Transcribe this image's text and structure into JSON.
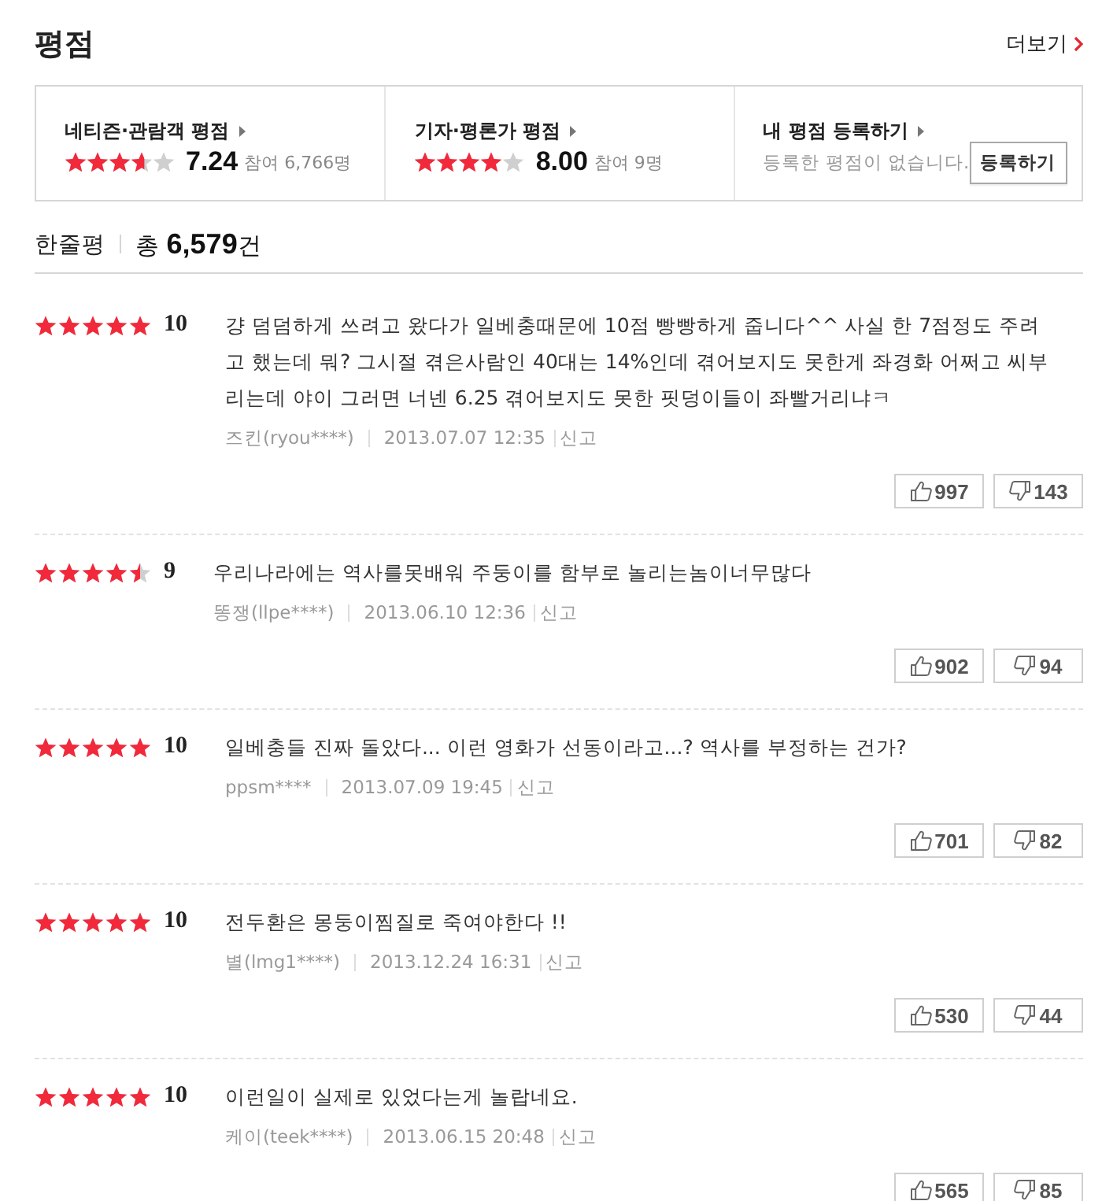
{
  "title": "평점",
  "more_link": "더보기",
  "rating_summary": [
    {
      "kind": "score",
      "label": "네티즌·관람객 평점",
      "stars": 3.62,
      "score": "7.24",
      "participants": "참여 6,766명"
    },
    {
      "kind": "score",
      "label": "기자·평론가 평점",
      "stars": 4,
      "score": "8.00",
      "participants": "참여 9명"
    },
    {
      "kind": "register",
      "label": "내 평점 등록하기",
      "message": "등록한 평점이 없습니다.",
      "button": "등록하기"
    }
  ],
  "reviews_header": {
    "label": "한줄평",
    "total": "총 **6,579**건"
  },
  "reviews": [
    {
      "stars": 5,
      "score": "10",
      "text": "걍 덤덤하게 쓰려고 왔다가 일베충때문에 10점 빵빵하게 줍니다^^ 사실 한 7점정도 주려고 했는데 뭐? 그시절 겪은사람인 40대는 14%인데 겪어보지도 못한게 좌경화 어쩌고 씨부리는데 야이 그러면 너넨 6.25 겪어보지도 못한 핏덩이들이 좌빨거리냐ㅋ",
      "author": "즈킨(ryou****)",
      "date": "2013.07.07 12:35",
      "report": "신고",
      "likes": "997",
      "dislikes": "143"
    },
    {
      "stars": 4.5,
      "score": "9",
      "text": "우리나라에는 역사를못배워 주둥이를 함부로 놀리는놈이너무많다",
      "author": "똥쟁(llpe****)",
      "date": "2013.06.10 12:36",
      "report": "신고",
      "likes": "902",
      "dislikes": "94"
    },
    {
      "stars": 5,
      "score": "10",
      "text": "일베충들 진짜 돌았다... 이런 영화가 선동이라고...? 역사를 부정하는 건가?",
      "author": "ppsm****",
      "date": "2013.07.09 19:45",
      "report": "신고",
      "likes": "701",
      "dislikes": "82"
    },
    {
      "stars": 5,
      "score": "10",
      "text": "전두환은 몽둥이찜질로 죽여야한다 !!",
      "author": "별(lmg1****)",
      "date": "2013.12.24 16:31",
      "report": "신고",
      "likes": "530",
      "dislikes": "44"
    },
    {
      "stars": 5,
      "score": "10",
      "text": "이런일이 실제로 있었다는게 놀랍네요.",
      "author": "케이(teek****)",
      "date": "2013.06.15 20:48",
      "report": "신고",
      "likes": "565",
      "dislikes": "85"
    }
  ]
}
